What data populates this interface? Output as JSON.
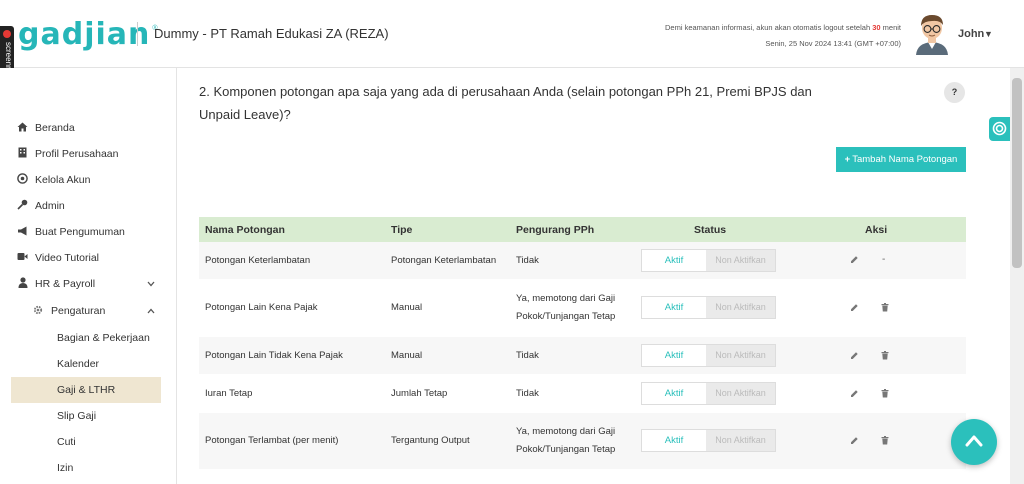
{
  "header": {
    "logo_text": "gadjian",
    "logo_reg": "®",
    "company": "Dummy - PT Ramah Edukasi ZA (REZA)",
    "notice_prefix": "Demi keamanan informasi, akun akan otomatis logout setelah",
    "notice_minutes": "30",
    "notice_suffix": "menit",
    "datetime": "Senin, 25 Nov 2024 13:41 (GMT +07:00)",
    "username": "John",
    "recorder_label": "screenrec"
  },
  "sidebar": {
    "items": [
      {
        "label": "Beranda",
        "icon": "home-icon"
      },
      {
        "label": "Profil Perusahaan",
        "icon": "building-icon"
      },
      {
        "label": "Kelola Akun",
        "icon": "account-icon"
      },
      {
        "label": "Admin",
        "icon": "key-icon"
      },
      {
        "label": "Buat Pengumuman",
        "icon": "megaphone-icon"
      },
      {
        "label": "Video Tutorial",
        "icon": "video-icon"
      },
      {
        "label": "HR & Payroll",
        "icon": "user-icon"
      }
    ],
    "sub_items": [
      {
        "label": "Pengaturan",
        "icon": "gear-icon"
      }
    ],
    "subsub_items": [
      {
        "label": "Bagian & Pekerjaan"
      },
      {
        "label": "Kalender"
      },
      {
        "label": "Gaji & LTHR"
      },
      {
        "label": "Slip Gaji"
      },
      {
        "label": "Cuti"
      },
      {
        "label": "Izin"
      }
    ],
    "active_item": "Gaji & LTHR"
  },
  "main": {
    "question": "2. Komponen potongan apa saja yang ada di perusahaan Anda (selain potongan PPh 21, Premi BPJS dan Unpaid Leave)?",
    "help_label": "?",
    "add_button": "Tambah Nama Potongan",
    "table": {
      "headers": [
        "Nama Potongan",
        "Tipe",
        "Pengurang PPh",
        "Status",
        "Aksi"
      ],
      "rows": [
        {
          "nama": "Potongan Keterlambatan",
          "tipe": "Potongan Keterlambatan",
          "pph": "Tidak",
          "on": "Aktif",
          "off": "Non Aktifkan",
          "delete": "-"
        },
        {
          "nama": "Potongan Lain Kena Pajak",
          "tipe": "Manual",
          "pph": "Ya, memotong dari Gaji Pokok/Tunjangan Tetap",
          "on": "Aktif",
          "off": "Non Aktifkan",
          "delete": "trash"
        },
        {
          "nama": "Potongan Lain Tidak Kena Pajak",
          "tipe": "Manual",
          "pph": "Tidak",
          "on": "Aktif",
          "off": "Non Aktifkan",
          "delete": "trash"
        },
        {
          "nama": "Iuran Tetap",
          "tipe": "Jumlah Tetap",
          "pph": "Tidak",
          "on": "Aktif",
          "off": "Non Aktifkan",
          "delete": "trash"
        },
        {
          "nama": "Potongan Terlambat (per menit)",
          "tipe": "Tergantung Output",
          "pph": "Ya, memotong dari Gaji Pokok/Tunjangan Tetap",
          "on": "Aktif",
          "off": "Non Aktifkan",
          "delete": "trash"
        }
      ]
    }
  },
  "colors": {
    "accent": "#2bc0bc",
    "table_header": "#d9ecd1",
    "active_nav": "#efe6d1",
    "notice_red": "#e53935"
  }
}
